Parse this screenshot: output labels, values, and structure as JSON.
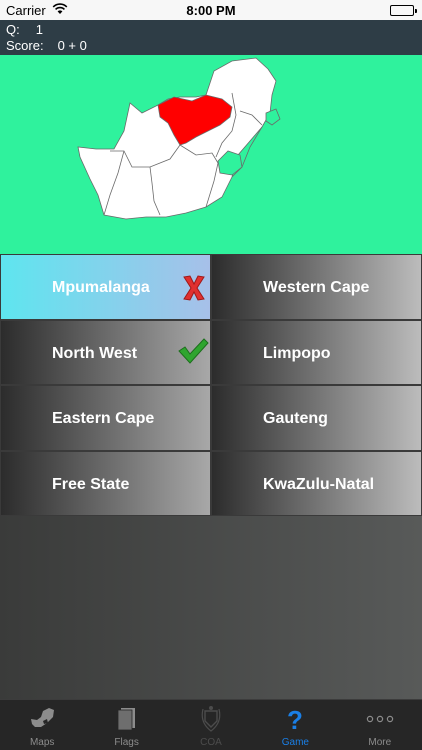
{
  "status_bar": {
    "carrier": "Carrier",
    "time": "8:00 PM"
  },
  "quiz": {
    "q_label": "Q:",
    "q_value": "1",
    "score_label": "Score:",
    "score_value": "0 + 0"
  },
  "map": {
    "highlighted_region": "North West",
    "highlight_color": "#ff0000",
    "background_color": "#2ff29d"
  },
  "answers": [
    {
      "label": "Mpumalanga",
      "state": "selected-wrong",
      "mark": "x-mark-icon"
    },
    {
      "label": "Western Cape",
      "state": "normal"
    },
    {
      "label": "North West",
      "state": "correct",
      "mark": "check-mark-icon"
    },
    {
      "label": "Limpopo",
      "state": "normal"
    },
    {
      "label": "Eastern Cape",
      "state": "normal"
    },
    {
      "label": "Gauteng",
      "state": "normal"
    },
    {
      "label": "Free State",
      "state": "normal"
    },
    {
      "label": "KwaZulu-Natal",
      "state": "normal"
    }
  ],
  "tabs": [
    {
      "label": "Maps",
      "icon": "map-icon"
    },
    {
      "label": "Flags",
      "icon": "flag-icon"
    },
    {
      "label": "COA",
      "icon": "coat-of-arms-icon",
      "disabled": true
    },
    {
      "label": "Game",
      "icon": "question-mark-icon",
      "active": true
    },
    {
      "label": "More",
      "icon": "more-dots-icon"
    }
  ],
  "colors": {
    "active_tab": "#1a7fe6",
    "wrong_mark": "#e03030",
    "correct_mark": "#2fa52f"
  }
}
